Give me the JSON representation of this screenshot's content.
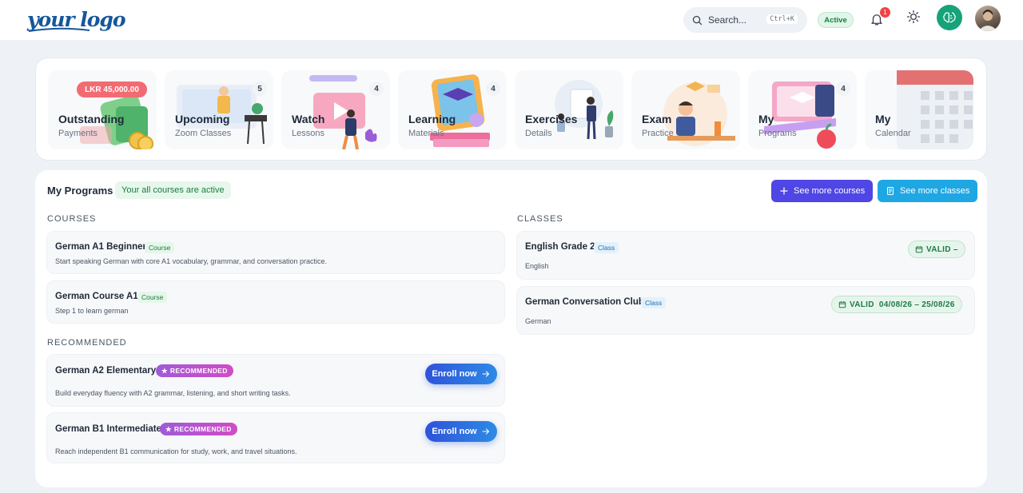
{
  "header": {
    "logo": "your logo",
    "search_label": "Search...",
    "search_shortcut": "Ctrl+K",
    "status": "Active",
    "notification_count": "1"
  },
  "tiles": [
    {
      "title": "Outstanding",
      "subtitle": "Payments",
      "badge": "LKR 45,000.00",
      "count": ""
    },
    {
      "title": "Upcoming",
      "subtitle": "Zoom Classes",
      "count": "5"
    },
    {
      "title": "Watch",
      "subtitle": "Lessons",
      "count": "4"
    },
    {
      "title": "Learning",
      "subtitle": "Materials",
      "count": "4"
    },
    {
      "title": "Exercises",
      "subtitle": "Details",
      "count": ""
    },
    {
      "title": "Exam",
      "subtitle": "Practice",
      "count": ""
    },
    {
      "title": "My",
      "subtitle": "Programs",
      "count": "4"
    },
    {
      "title": "My",
      "subtitle": "Calendar",
      "count": ""
    }
  ],
  "programs": {
    "title": "My Programs",
    "status_pill": "Your all courses are active",
    "see_more_courses": "See more courses",
    "see_more_classes": "See more classes",
    "courses_heading": "COURSES",
    "classes_heading": "CLASSES",
    "recommended_heading": "RECOMMENDED",
    "courses": [
      {
        "name": "German A1 Beginner",
        "tag": "Course",
        "description": "Start speaking German with core A1 vocabulary, grammar, and conversation practice."
      },
      {
        "name": "German Course A1",
        "tag": "Course",
        "description": "Step 1 to learn german"
      }
    ],
    "recommended": [
      {
        "name": "German A2 Elementary",
        "tag": "RECOMMENDED",
        "description": "Build everyday fluency with A2 grammar, listening, and short writing tasks.",
        "action": "Enroll now"
      },
      {
        "name": "German B1 Intermediate",
        "tag": "RECOMMENDED",
        "description": "Reach independent B1 communication for study, work, and travel situations.",
        "action": "Enroll now"
      }
    ],
    "classes": [
      {
        "name": "English Grade 2",
        "tag": "Class",
        "language": "English",
        "validity": "VALID –"
      },
      {
        "name": "German Conversation Club",
        "tag": "Class",
        "language": "German",
        "validity": "VALID  04/08/26 – 25/08/26"
      }
    ]
  },
  "colors": {
    "primary": "#4f46e5",
    "secondary": "#1ea7e3",
    "success": "#15803d",
    "danger": "#ef4444"
  }
}
